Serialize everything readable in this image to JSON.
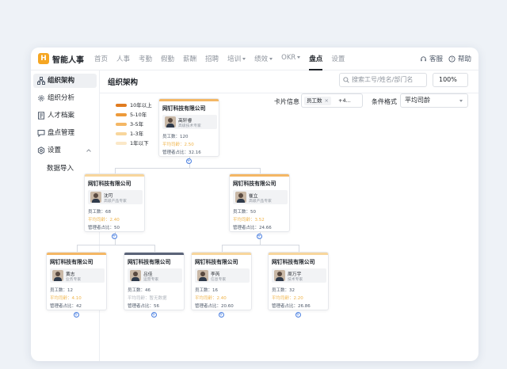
{
  "app": {
    "logo_letter": "H",
    "name": "智能人事",
    "accent": "#f5a623"
  },
  "nav": [
    {
      "label": "首页",
      "dropdown": false,
      "active": false
    },
    {
      "label": "人事",
      "dropdown": false,
      "active": false
    },
    {
      "label": "考勤",
      "dropdown": false,
      "active": false
    },
    {
      "label": "假勤",
      "dropdown": false,
      "active": false
    },
    {
      "label": "薪酬",
      "dropdown": false,
      "active": false
    },
    {
      "label": "招聘",
      "dropdown": false,
      "active": false
    },
    {
      "label": "培训",
      "dropdown": true,
      "active": false
    },
    {
      "label": "绩效",
      "dropdown": true,
      "active": false
    },
    {
      "label": "OKR",
      "dropdown": true,
      "active": false
    },
    {
      "label": "盘点",
      "dropdown": false,
      "active": true
    },
    {
      "label": "设置",
      "dropdown": false,
      "active": false
    }
  ],
  "topright": {
    "service": "客服",
    "help": "帮助"
  },
  "sidebar": {
    "items": [
      {
        "label": "组织架构",
        "icon": "org-chart-icon",
        "active": true
      },
      {
        "label": "组织分析",
        "icon": "gear-icon",
        "active": false
      },
      {
        "label": "人才档案",
        "icon": "document-icon",
        "active": false
      },
      {
        "label": "盘点管理",
        "icon": "chat-icon",
        "active": false
      },
      {
        "label": "设置",
        "icon": "settings-icon",
        "active": false,
        "expanded": true
      }
    ],
    "sub_items": [
      {
        "label": "数据导入"
      }
    ]
  },
  "main": {
    "title": "组织架构",
    "search_placeholder": "搜索工号/姓名/部门名",
    "zoom": "100%",
    "card_info_label": "卡片信息",
    "card_info_chip": "员工数",
    "card_info_more": "+4...",
    "condition_label": "条件格式",
    "condition_value": "平均司龄"
  },
  "legend": [
    {
      "label": "10年以上",
      "color": "#e07b1f"
    },
    {
      "label": "5-10年",
      "color": "#ed9a3a"
    },
    {
      "label": "3-5年",
      "color": "#f4b765"
    },
    {
      "label": "1-3年",
      "color": "#f8d69c"
    },
    {
      "label": "1年以下",
      "color": "#fbe8c8"
    }
  ],
  "stat_labels": {
    "employees": "员工数",
    "avg_tenure": "平均司龄",
    "mgmt_ratio": "管理者占比"
  },
  "nodes": [
    {
      "company": "网钉科技有限公司",
      "name": "高轩睿",
      "title": "高级技术专家",
      "employees": "120",
      "avg_tenure": "2.50",
      "mgmt_ratio": "32.16",
      "bar_color": "#f4b765",
      "tenure_color": "#f0b44a"
    },
    {
      "company": "网钉科技有限公司",
      "name": "沈可",
      "title": "高级产品专家",
      "employees": "68",
      "avg_tenure": "2.40",
      "mgmt_ratio": "50",
      "bar_color": "#f8d69c",
      "tenure_color": "#f0b44a"
    },
    {
      "company": "网钉科技有限公司",
      "name": "崔立",
      "title": "高级产品专家",
      "employees": "50",
      "avg_tenure": "3.52",
      "mgmt_ratio": "24.66",
      "bar_color": "#f4b765",
      "tenure_color": "#f0b44a"
    },
    {
      "company": "网钉科技有限公司",
      "name": "黄志",
      "title": "业务专家",
      "employees": "12",
      "avg_tenure": "4.10",
      "mgmt_ratio": "42",
      "bar_color": "#f4b765",
      "tenure_color": "#f0b44a"
    },
    {
      "company": "网钉科技有限公司",
      "name": "吕佳",
      "title": "运营专家",
      "employees": "46",
      "avg_tenure": "暂无数据",
      "mgmt_ratio": "56",
      "bar_color": "#5b6478",
      "tenure_color": "#b0b5bd"
    },
    {
      "company": "网钉科技有限公司",
      "name": "李芮",
      "title": "信息专家",
      "employees": "16",
      "avg_tenure": "2.40",
      "mgmt_ratio": "20.60",
      "bar_color": "#f8d69c",
      "tenure_color": "#f0b44a"
    },
    {
      "company": "网钉科技有限公司",
      "name": "周万宇",
      "title": "技术专家",
      "employees": "32",
      "avg_tenure": "2.20",
      "mgmt_ratio": "26.86",
      "bar_color": "#f8d69c",
      "tenure_color": "#f0b44a"
    }
  ]
}
